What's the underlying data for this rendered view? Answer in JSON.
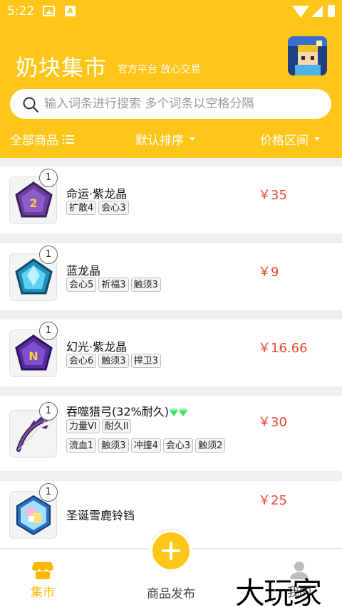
{
  "status_bar": {
    "time": "5:22",
    "a_badge": "A"
  },
  "header": {
    "title": "奶块集市",
    "slogan": "官方平台 放心交易"
  },
  "search": {
    "placeholder": "输入词条进行搜索 多个词条以空格分隔"
  },
  "filters": {
    "all_products": "全部商品",
    "sort": "默认排序",
    "price_range": "价格区间"
  },
  "items": [
    {
      "qty": "1",
      "name": "命运·紫龙晶",
      "tags_rows": [
        [
          "扩散4",
          "会心3"
        ]
      ],
      "price": "￥35",
      "icon": "purple-crystal-2-icon"
    },
    {
      "qty": "1",
      "name": "蓝龙晶",
      "tags_rows": [
        [
          "会心5",
          "祈福3",
          "触须3"
        ]
      ],
      "price": "￥9",
      "icon": "blue-crystal-icon"
    },
    {
      "qty": "1",
      "name": "幻光·紫龙晶",
      "tags_rows": [
        [
          "会心6",
          "触须3",
          "捍卫3"
        ]
      ],
      "price": "￥16.66",
      "icon": "purple-crystal-n-icon"
    },
    {
      "qty": "1",
      "name": "吞噬猎弓(32%耐久)",
      "tags_rows": [
        [
          "力量VI",
          "耐久II"
        ],
        [
          "流血1",
          "触须3",
          "冲撞4",
          "会心3",
          "触须2"
        ]
      ],
      "price": "￥30",
      "icon": "bow-icon"
    },
    {
      "qty": "1",
      "name": "圣诞雪鹿铃铛",
      "tags_rows": [],
      "price": "￥25",
      "icon": "bell-icon"
    }
  ],
  "tabbar": {
    "market": "集市",
    "publish": "商品发布",
    "mine": "我的"
  },
  "watermark": "大玩家",
  "colors": {
    "accent": "#ffc61a",
    "price": "#f24430",
    "active_tab": "#ffb800"
  }
}
